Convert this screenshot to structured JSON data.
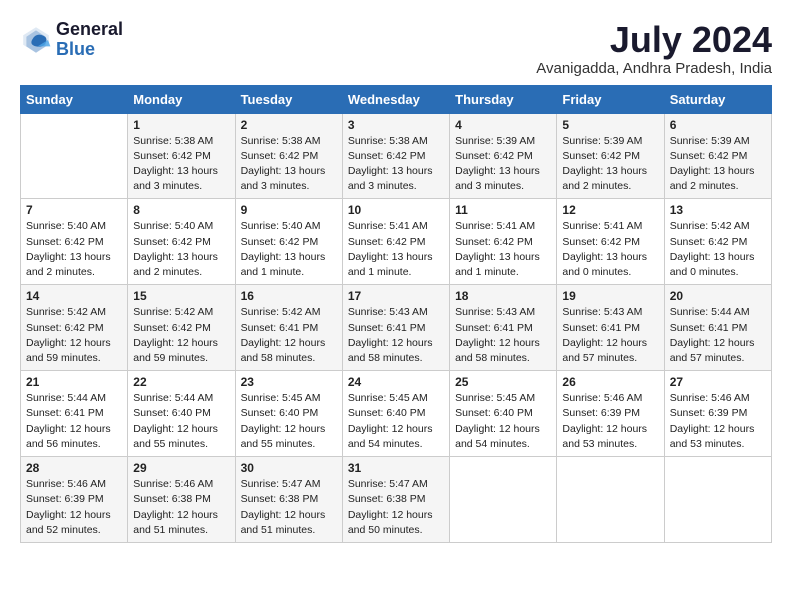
{
  "logo": {
    "line1": "General",
    "line2": "Blue"
  },
  "title": "July 2024",
  "subtitle": "Avanigadda, Andhra Pradesh, India",
  "headers": [
    "Sunday",
    "Monday",
    "Tuesday",
    "Wednesday",
    "Thursday",
    "Friday",
    "Saturday"
  ],
  "weeks": [
    [
      {
        "day": "",
        "info": ""
      },
      {
        "day": "1",
        "info": "Sunrise: 5:38 AM\nSunset: 6:42 PM\nDaylight: 13 hours\nand 3 minutes."
      },
      {
        "day": "2",
        "info": "Sunrise: 5:38 AM\nSunset: 6:42 PM\nDaylight: 13 hours\nand 3 minutes."
      },
      {
        "day": "3",
        "info": "Sunrise: 5:38 AM\nSunset: 6:42 PM\nDaylight: 13 hours\nand 3 minutes."
      },
      {
        "day": "4",
        "info": "Sunrise: 5:39 AM\nSunset: 6:42 PM\nDaylight: 13 hours\nand 3 minutes."
      },
      {
        "day": "5",
        "info": "Sunrise: 5:39 AM\nSunset: 6:42 PM\nDaylight: 13 hours\nand 2 minutes."
      },
      {
        "day": "6",
        "info": "Sunrise: 5:39 AM\nSunset: 6:42 PM\nDaylight: 13 hours\nand 2 minutes."
      }
    ],
    [
      {
        "day": "7",
        "info": "Sunrise: 5:40 AM\nSunset: 6:42 PM\nDaylight: 13 hours\nand 2 minutes."
      },
      {
        "day": "8",
        "info": "Sunrise: 5:40 AM\nSunset: 6:42 PM\nDaylight: 13 hours\nand 2 minutes."
      },
      {
        "day": "9",
        "info": "Sunrise: 5:40 AM\nSunset: 6:42 PM\nDaylight: 13 hours\nand 1 minute."
      },
      {
        "day": "10",
        "info": "Sunrise: 5:41 AM\nSunset: 6:42 PM\nDaylight: 13 hours\nand 1 minute."
      },
      {
        "day": "11",
        "info": "Sunrise: 5:41 AM\nSunset: 6:42 PM\nDaylight: 13 hours\nand 1 minute."
      },
      {
        "day": "12",
        "info": "Sunrise: 5:41 AM\nSunset: 6:42 PM\nDaylight: 13 hours\nand 0 minutes."
      },
      {
        "day": "13",
        "info": "Sunrise: 5:42 AM\nSunset: 6:42 PM\nDaylight: 13 hours\nand 0 minutes."
      }
    ],
    [
      {
        "day": "14",
        "info": "Sunrise: 5:42 AM\nSunset: 6:42 PM\nDaylight: 12 hours\nand 59 minutes."
      },
      {
        "day": "15",
        "info": "Sunrise: 5:42 AM\nSunset: 6:42 PM\nDaylight: 12 hours\nand 59 minutes."
      },
      {
        "day": "16",
        "info": "Sunrise: 5:42 AM\nSunset: 6:41 PM\nDaylight: 12 hours\nand 58 minutes."
      },
      {
        "day": "17",
        "info": "Sunrise: 5:43 AM\nSunset: 6:41 PM\nDaylight: 12 hours\nand 58 minutes."
      },
      {
        "day": "18",
        "info": "Sunrise: 5:43 AM\nSunset: 6:41 PM\nDaylight: 12 hours\nand 58 minutes."
      },
      {
        "day": "19",
        "info": "Sunrise: 5:43 AM\nSunset: 6:41 PM\nDaylight: 12 hours\nand 57 minutes."
      },
      {
        "day": "20",
        "info": "Sunrise: 5:44 AM\nSunset: 6:41 PM\nDaylight: 12 hours\nand 57 minutes."
      }
    ],
    [
      {
        "day": "21",
        "info": "Sunrise: 5:44 AM\nSunset: 6:41 PM\nDaylight: 12 hours\nand 56 minutes."
      },
      {
        "day": "22",
        "info": "Sunrise: 5:44 AM\nSunset: 6:40 PM\nDaylight: 12 hours\nand 55 minutes."
      },
      {
        "day": "23",
        "info": "Sunrise: 5:45 AM\nSunset: 6:40 PM\nDaylight: 12 hours\nand 55 minutes."
      },
      {
        "day": "24",
        "info": "Sunrise: 5:45 AM\nSunset: 6:40 PM\nDaylight: 12 hours\nand 54 minutes."
      },
      {
        "day": "25",
        "info": "Sunrise: 5:45 AM\nSunset: 6:40 PM\nDaylight: 12 hours\nand 54 minutes."
      },
      {
        "day": "26",
        "info": "Sunrise: 5:46 AM\nSunset: 6:39 PM\nDaylight: 12 hours\nand 53 minutes."
      },
      {
        "day": "27",
        "info": "Sunrise: 5:46 AM\nSunset: 6:39 PM\nDaylight: 12 hours\nand 53 minutes."
      }
    ],
    [
      {
        "day": "28",
        "info": "Sunrise: 5:46 AM\nSunset: 6:39 PM\nDaylight: 12 hours\nand 52 minutes."
      },
      {
        "day": "29",
        "info": "Sunrise: 5:46 AM\nSunset: 6:38 PM\nDaylight: 12 hours\nand 51 minutes."
      },
      {
        "day": "30",
        "info": "Sunrise: 5:47 AM\nSunset: 6:38 PM\nDaylight: 12 hours\nand 51 minutes."
      },
      {
        "day": "31",
        "info": "Sunrise: 5:47 AM\nSunset: 6:38 PM\nDaylight: 12 hours\nand 50 minutes."
      },
      {
        "day": "",
        "info": ""
      },
      {
        "day": "",
        "info": ""
      },
      {
        "day": "",
        "info": ""
      }
    ]
  ]
}
